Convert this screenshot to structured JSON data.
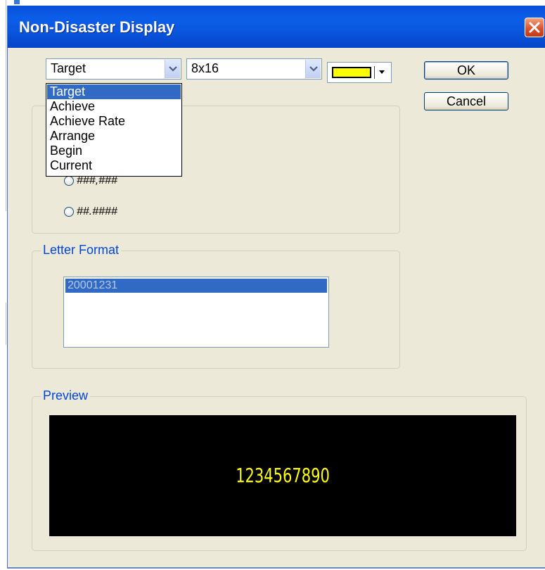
{
  "window": {
    "title": "Non-Disaster Display"
  },
  "toolbar": {
    "field_combo_value": "Target",
    "size_combo_value": "8x16",
    "text_color": "#ffff00"
  },
  "buttons": {
    "ok": "OK",
    "cancel": "Cancel"
  },
  "dropdown": {
    "items": [
      "Target",
      "Achieve",
      "Achieve Rate",
      "Arrange",
      "Begin",
      "Current"
    ],
    "selected_index": 0
  },
  "number_format": {
    "options": [
      "###,###",
      "##.####"
    ]
  },
  "letter_format": {
    "label": "Letter Format",
    "items": [
      "20001231"
    ],
    "selected_index": 0
  },
  "preview": {
    "label": "Preview",
    "sample_text": "1234567890",
    "background": "#000000",
    "text_color": "#ffff00"
  },
  "icons": [
    "chevron-down-icon",
    "close-icon"
  ]
}
